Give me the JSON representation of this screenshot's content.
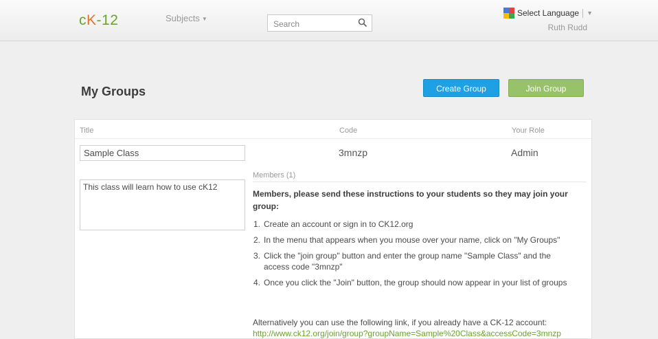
{
  "header": {
    "logo": {
      "left": "c",
      "k": "K",
      "right": "-12"
    },
    "subjects_label": "Subjects",
    "search_placeholder": "Search",
    "language_label": "Select Language",
    "user_name": "Ruth Rudd"
  },
  "main": {
    "page_title": "My Groups",
    "create_group_label": "Create Group",
    "join_group_label": "Join Group",
    "columns": {
      "title": "Title",
      "code": "Code",
      "role": "Your Role"
    },
    "group": {
      "title": "Sample Class",
      "code": "3mnzp",
      "role": "Admin",
      "description": "This class will learn how to use cK12"
    },
    "members_label": "Members (1)",
    "instructions_heading": "Members, please send these instructions to your students so they may join your group:",
    "steps": [
      {
        "num": "1.",
        "text": "Create an account or sign in to CK12.org"
      },
      {
        "num": "2.",
        "text": "In the menu that appears when you mouse over your name, click on \"My Groups\""
      },
      {
        "num": "3.",
        "text": "Click the \"join group\" button and enter the group name \"Sample Class\" and the access code \"3mnzp\""
      },
      {
        "num": "4.",
        "text": "Once you click the \"Join\" button, the group should now appear in your list of groups"
      }
    ],
    "alternative_text": "Alternatively you can use the following link, if you already have a CK-12 account:",
    "alternative_link": "http://www.ck12.org/join/group?groupName=Sample%20Class&accessCode=3mnzp"
  },
  "colors": {
    "brand_green": "#6aa32b",
    "brand_orange": "#e3742a",
    "create_blue": "#1ea0e4",
    "join_green": "#98c26a"
  },
  "icons": {
    "search": "search-icon",
    "language": "google-translate-icon",
    "dropdown": "chevron-down-icon"
  }
}
